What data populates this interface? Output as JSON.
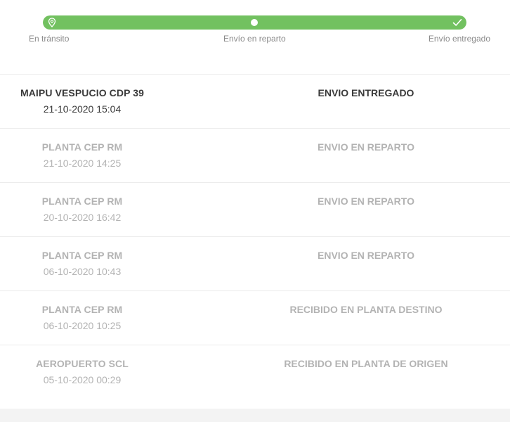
{
  "progress": {
    "fill_fraction": 1.0,
    "accent_color": "#72c160",
    "steps": [
      {
        "label": "En tránsito",
        "icon": "location-pin-icon"
      },
      {
        "label": "Envío en reparto",
        "icon": "dot-icon"
      },
      {
        "label": "Envío entregado",
        "icon": "checkmark-icon"
      }
    ]
  },
  "events": [
    {
      "place": "MAIPU VESPUCIO CDP 39",
      "datetime": "21-10-2020 15:04",
      "status": "ENVIO ENTREGADO",
      "state": "active"
    },
    {
      "place": "PLANTA CEP RM",
      "datetime": "21-10-2020 14:25",
      "status": "ENVIO EN REPARTO",
      "state": "past"
    },
    {
      "place": "PLANTA CEP RM",
      "datetime": "20-10-2020 16:42",
      "status": "ENVIO EN REPARTO",
      "state": "past"
    },
    {
      "place": "PLANTA CEP RM",
      "datetime": "06-10-2020 10:43",
      "status": "ENVIO EN REPARTO",
      "state": "past"
    },
    {
      "place": "PLANTA CEP RM",
      "datetime": "06-10-2020 10:25",
      "status": "RECIBIDO EN PLANTA DESTINO",
      "state": "past"
    },
    {
      "place": "AEROPUERTO SCL",
      "datetime": "05-10-2020 00:29",
      "status": "RECIBIDO EN PLANTA DE ORIGEN",
      "state": "past"
    }
  ]
}
